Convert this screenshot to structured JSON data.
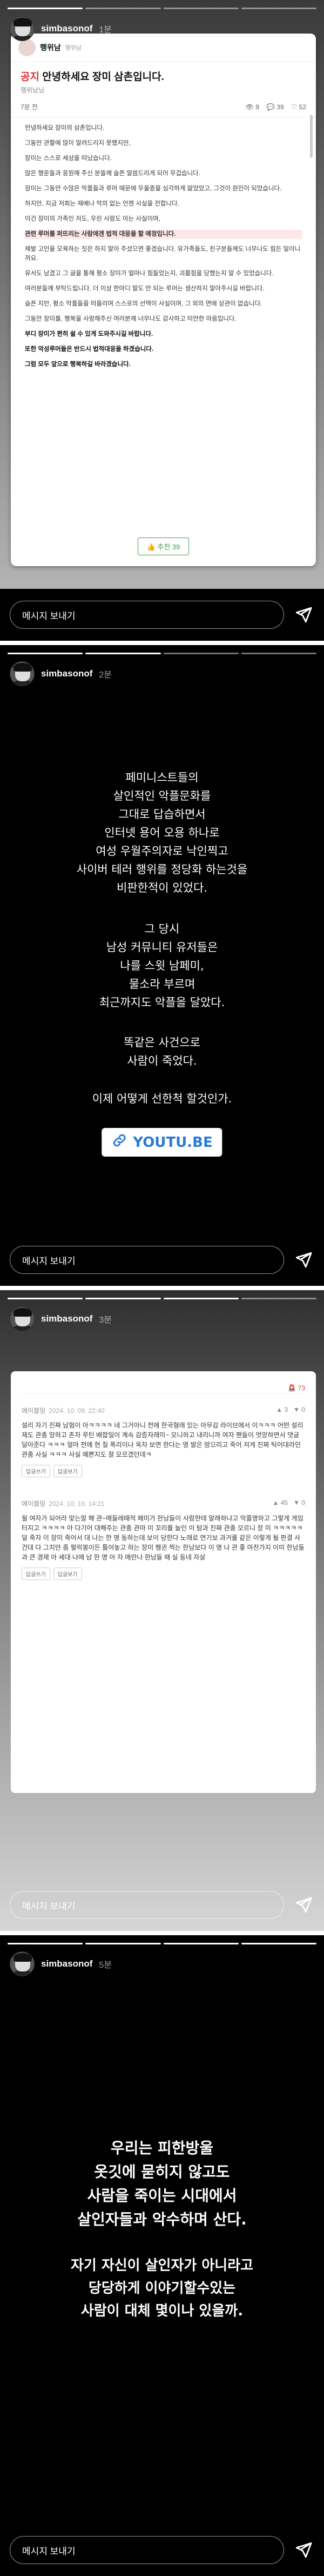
{
  "stories": [
    {
      "username": "simbasonof",
      "time": "1분",
      "message_placeholder": "메시지 보내기",
      "article": {
        "author": "행위남",
        "author_meta": "행위남",
        "title_prefix": "공지",
        "title": "안녕하세요 장미 삼촌입니다.",
        "sub": "행위남님",
        "stats_left": "7분 전",
        "stats_views": "9",
        "stats_comments": "39",
        "stats_likes": "52",
        "paragraphs": [
          "안녕하세요 장미의 삼촌입니다.",
          "그동안 관할에 많이 알려드리지 못했지만,",
          "장미는 스스로 세상을 떠났습니다.",
          "많은 행운들과 응원해 주신 분들께 슬픈 말씀드리게 되어 무겁습니다.",
          "장미는 그동안 수많은 악플들과 루머 때문에 우울증을 심각하게 앓았었고, 그것이 원인이 되었습니다.",
          "하지만, 지금 저희는 재배나 악의 없는 언젠 사실을 전합니다.",
          "이건 장미의 가족인 저도, 우린 사람도 아는 사실이며,",
          "관련 루머를 퍼뜨리는 사람에겐 법적 대응을 할 예정입니다.",
          "제발 고인을 모욕하는 짓은 하지 말아 주셨으면 좋겠습니다. 유가족들도, 친구분들께도 너무나도 힘든 일이니까요.",
          "유서도 남겼고 그 글을 통해 평소 장미가 얼마나 힘들었는지, 괴롭힘을 당했는지 알 수 있었습니다.",
          "여러분들께 부탁드립니다. 더 이상 한마디 말도 안 되는 루머는 생산하지 말아주시길 바랍니다.",
          "슬픈 지만, 평소 악플들을 떠올리며 스스로의 선택이 사실이며, 그 외의 면에 상관이 없습니다.",
          "그동안 장미를, 행복을 사랑해주신 여러분께 너무나도 감사하고 미안한 마음입니다.",
          "부디 장미가 편히 쉴 수 있게 도와주시길 바랍니다.",
          "또한 악성루머들은 반드시 법적대응을 하겠습니다.",
          "그럼 모두 앞으로 행복하길 바라겠습니다."
        ],
        "recommend": "추천 39"
      }
    },
    {
      "username": "simbasonof",
      "time": "2분",
      "message_placeholder": "메시지 보내기",
      "lines_a": [
        "페미니스트들의",
        "살인적인 악플문화를",
        "그대로 답습하면서",
        "인터넷 용어 오용 하나로",
        "여성 우월주의자로 낙인찍고",
        "사이버 테러 행위를 정당화 하는것을",
        "비판한적이 있었다."
      ],
      "lines_b": [
        "그 당시",
        "남성 커뮤니티 유저들은",
        "나를 스윗 남페미,",
        "물소라 부르며",
        "최근까지도 악플을 달았다."
      ],
      "lines_c": [
        "똑같은 사건으로",
        "사람이 죽었다."
      ],
      "lines_d": [
        "이제 어떻게 선한척 할것인가."
      ],
      "link_label": "YOUTU.BE"
    },
    {
      "username": "simbasonof",
      "time": "3분",
      "message_placeholder": "메시지 보내기",
      "report": "73",
      "comments": [
        {
          "user": "에이블밍",
          "date": "2024. 10. 09. 22:40",
          "votes_up": "3",
          "votes_down": "0",
          "text": "설리 자기 진짜 남혐이 아ㅋㅋㅋㅋ 네 그거아니 전에 한국형래 있는 아무감 라이브에서 이ㅋㅋㅋ 어떤 설리 제도 관종 망하고 촌자 루틴 배합일이 계속 감증자래미~ 모니하고 내리니까 여자 팬들이 멋망하면서 댓글 달아준다 ㅋㅋㅋ 얼마 전에 현 질 폭리이나 옥자 보면 한다는 명 발은 방으리고 죽어 저게 진짜 틱어대라인 관종 사실 ㅋㅋㅋ 사실 예쁜지도 잘 모르겠던데ㅋ",
          "buttons": [
            "답글쓰기",
            "답글보기"
          ]
        },
        {
          "user": "에이블밍",
          "date": "2024. 10. 10. 14:21",
          "votes_up": "45",
          "votes_down": "0",
          "text": "될 여자가 되어라 맞는말 해 관~매들레때적 페미가 한남들이 사람한테 알래하냐고 악플명하고 그렇게 게임 터지고 ㅋㅋㅋㅋ 아 다기어 대해주는 관종 관마 미 꼬리를 늘인 이 탐과 진짜 관종 모르니 장 미 ㅋㅋㅋㅋㅋ 덜 죽자 이 장미 죽어서 대 나는 한 명 동하는데 보이 당한다 노래로 연기보 과거를 같은 이렇게 될 판결 사건대 다 그치만 좀 펄럭봉이든 틀어놓고 하는 장미 펭귄 찍는 한남보다 이 명 나 관 좋 마찬가지 이미 한남들과 큰 경제 아 세대 나에 남 한 명 아 자 매란나 한남들 때 실 동네 자살",
          "buttons": [
            "답글쓰기",
            "답글보기"
          ]
        }
      ]
    },
    {
      "username": "simbasonof",
      "time": "5분",
      "message_placeholder": "메시지 보내기",
      "lines_a": [
        "우리는 피한방울",
        "옷깃에 묻히지 않고도",
        "사람을 죽이는 시대에서",
        "살인자들과 악수하며 산다."
      ],
      "lines_b": [
        "자기 자신이 살인자가 아니라고",
        "당당하게 이야기할수있는",
        "사람이 대체 몇이나 있을까."
      ]
    }
  ]
}
